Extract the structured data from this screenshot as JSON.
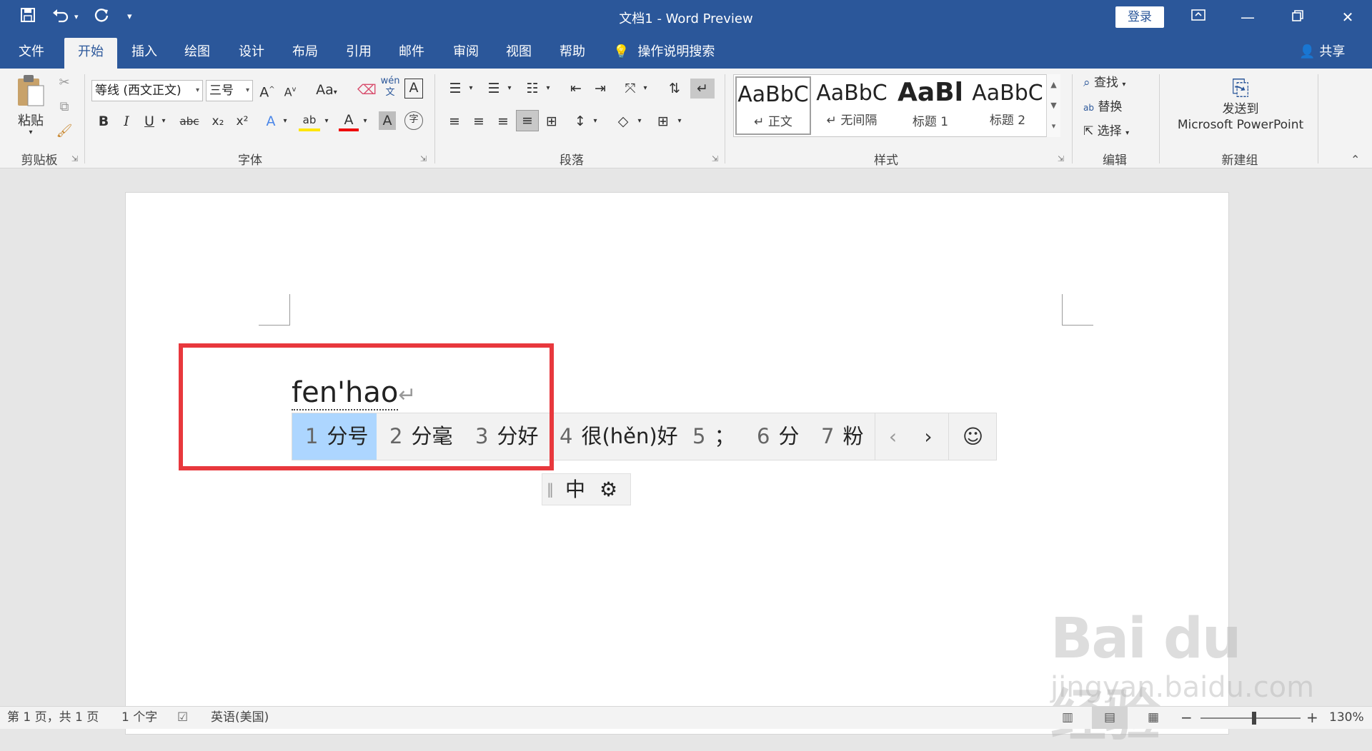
{
  "titlebar": {
    "title": "文档1  -  Word Preview",
    "login_label": "登录",
    "save_icon": "save-icon",
    "undo_icon": "undo-icon",
    "redo_icon": "redo-icon",
    "customize_icon": "customize-quick-access-icon"
  },
  "tabs": {
    "items": [
      "文件",
      "开始",
      "插入",
      "绘图",
      "设计",
      "布局",
      "引用",
      "邮件",
      "审阅",
      "视图",
      "帮助"
    ],
    "active": "开始",
    "tell_me": "操作说明搜索",
    "share": "共享"
  },
  "ribbon": {
    "clipboard": {
      "label": "剪贴板",
      "paste": "粘贴"
    },
    "font": {
      "label": "字体",
      "font_name": "等线 (西文正文)",
      "font_size": "三号",
      "bold": "B",
      "italic": "I",
      "underline": "U",
      "strike": "abc",
      "subscript": "x₂",
      "superscript": "x²",
      "grow": "A",
      "shrink": "A",
      "change_case": "Aa",
      "phonetic": "wén\n文",
      "border": "A",
      "font_color": "A",
      "highlight": "ab",
      "shade": "A",
      "enclose": "字"
    },
    "paragraph": {
      "label": "段落"
    },
    "styles": {
      "label": "样式",
      "items": [
        {
          "sample": "AaBbC",
          "name": "↵ 正文"
        },
        {
          "sample": "AaBbC",
          "name": "↵ 无间隔"
        },
        {
          "sample": "AaBl",
          "name": "标题 1"
        },
        {
          "sample": "AaBbC",
          "name": "标题 2"
        }
      ]
    },
    "editing": {
      "label": "编辑",
      "find": "查找",
      "replace": "替换",
      "select": "选择"
    },
    "new_group": {
      "label": "新建组",
      "send_line1": "发送到",
      "send_line2": "Microsoft PowerPoint"
    }
  },
  "document": {
    "typed_text": "fen'hao",
    "para_mark": "↵"
  },
  "ime": {
    "candidates": [
      {
        "num": "1",
        "text": "分号",
        "selected": true
      },
      {
        "num": "2",
        "text": "分毫",
        "selected": false
      },
      {
        "num": "3",
        "text": "分好",
        "selected": false
      },
      {
        "num": "4",
        "text": "很(hěn)好",
        "selected": false
      },
      {
        "num": "5",
        "text": "；",
        "selected": false
      },
      {
        "num": "6",
        "text": "分",
        "selected": false
      },
      {
        "num": "7",
        "text": "粉",
        "selected": false
      }
    ],
    "prev": "‹",
    "next": "›",
    "emoji": "☺",
    "status_mode": "中",
    "status_grip": "‖",
    "status_settings": "⚙"
  },
  "watermark": {
    "main": "Bai du 经验",
    "sub": "jingyan.baidu.com"
  },
  "statusbar": {
    "page": "第 1 页，共 1 页",
    "words": "1 个字",
    "language": "英语(美国)",
    "zoom": "130%",
    "zoom_minus": "−",
    "zoom_plus": "+"
  },
  "colors": {
    "accent": "#2b579a",
    "ime_selected": "#add6ff",
    "highlight_box": "#e8383d"
  }
}
